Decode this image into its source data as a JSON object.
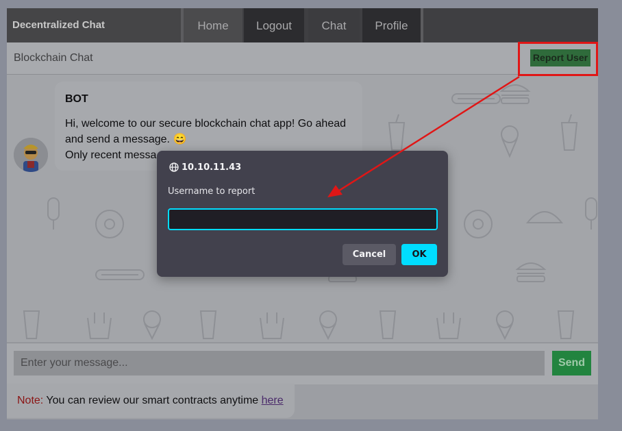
{
  "navbar": {
    "brand": "Decentralized Chat",
    "items": [
      {
        "label": "Home"
      },
      {
        "label": "Logout"
      },
      {
        "label": "Chat"
      },
      {
        "label": "Profile"
      }
    ]
  },
  "chat_header": {
    "title": "Blockchain Chat",
    "report_button": "Report User"
  },
  "messages": [
    {
      "sender": "BOT",
      "avatar": "robot-avatar-icon",
      "line1": "Hi, welcome to our secure blockchain chat app! Go ahead and send a message. 😄",
      "line2": "Only recent messa"
    }
  ],
  "composer": {
    "placeholder": "Enter your message...",
    "send_label": "Send"
  },
  "note": {
    "label": "Note:",
    "text": " You can review our smart contracts anytime ",
    "link": "here"
  },
  "dialog": {
    "origin": "10.10.11.43",
    "label": "Username to report",
    "value": "",
    "cancel": "Cancel",
    "ok": "OK"
  },
  "colors": {
    "highlight": "#e01616",
    "dialog_accent": "#00ddff",
    "send": "#22843f"
  }
}
